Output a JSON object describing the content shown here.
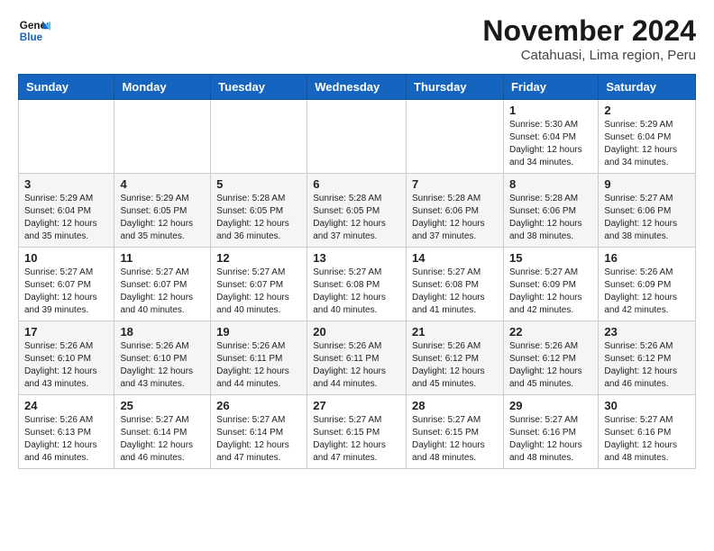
{
  "logo": {
    "line1": "General",
    "line2": "Blue"
  },
  "title": "November 2024",
  "subtitle": "Catahuasi, Lima region, Peru",
  "days_of_week": [
    "Sunday",
    "Monday",
    "Tuesday",
    "Wednesday",
    "Thursday",
    "Friday",
    "Saturday"
  ],
  "weeks": [
    [
      {
        "day": "",
        "info": ""
      },
      {
        "day": "",
        "info": ""
      },
      {
        "day": "",
        "info": ""
      },
      {
        "day": "",
        "info": ""
      },
      {
        "day": "",
        "info": ""
      },
      {
        "day": "1",
        "info": "Sunrise: 5:30 AM\nSunset: 6:04 PM\nDaylight: 12 hours and 34 minutes."
      },
      {
        "day": "2",
        "info": "Sunrise: 5:29 AM\nSunset: 6:04 PM\nDaylight: 12 hours and 34 minutes."
      }
    ],
    [
      {
        "day": "3",
        "info": "Sunrise: 5:29 AM\nSunset: 6:04 PM\nDaylight: 12 hours and 35 minutes."
      },
      {
        "day": "4",
        "info": "Sunrise: 5:29 AM\nSunset: 6:05 PM\nDaylight: 12 hours and 35 minutes."
      },
      {
        "day": "5",
        "info": "Sunrise: 5:28 AM\nSunset: 6:05 PM\nDaylight: 12 hours and 36 minutes."
      },
      {
        "day": "6",
        "info": "Sunrise: 5:28 AM\nSunset: 6:05 PM\nDaylight: 12 hours and 37 minutes."
      },
      {
        "day": "7",
        "info": "Sunrise: 5:28 AM\nSunset: 6:06 PM\nDaylight: 12 hours and 37 minutes."
      },
      {
        "day": "8",
        "info": "Sunrise: 5:28 AM\nSunset: 6:06 PM\nDaylight: 12 hours and 38 minutes."
      },
      {
        "day": "9",
        "info": "Sunrise: 5:27 AM\nSunset: 6:06 PM\nDaylight: 12 hours and 38 minutes."
      }
    ],
    [
      {
        "day": "10",
        "info": "Sunrise: 5:27 AM\nSunset: 6:07 PM\nDaylight: 12 hours and 39 minutes."
      },
      {
        "day": "11",
        "info": "Sunrise: 5:27 AM\nSunset: 6:07 PM\nDaylight: 12 hours and 40 minutes."
      },
      {
        "day": "12",
        "info": "Sunrise: 5:27 AM\nSunset: 6:07 PM\nDaylight: 12 hours and 40 minutes."
      },
      {
        "day": "13",
        "info": "Sunrise: 5:27 AM\nSunset: 6:08 PM\nDaylight: 12 hours and 40 minutes."
      },
      {
        "day": "14",
        "info": "Sunrise: 5:27 AM\nSunset: 6:08 PM\nDaylight: 12 hours and 41 minutes."
      },
      {
        "day": "15",
        "info": "Sunrise: 5:27 AM\nSunset: 6:09 PM\nDaylight: 12 hours and 42 minutes."
      },
      {
        "day": "16",
        "info": "Sunrise: 5:26 AM\nSunset: 6:09 PM\nDaylight: 12 hours and 42 minutes."
      }
    ],
    [
      {
        "day": "17",
        "info": "Sunrise: 5:26 AM\nSunset: 6:10 PM\nDaylight: 12 hours and 43 minutes."
      },
      {
        "day": "18",
        "info": "Sunrise: 5:26 AM\nSunset: 6:10 PM\nDaylight: 12 hours and 43 minutes."
      },
      {
        "day": "19",
        "info": "Sunrise: 5:26 AM\nSunset: 6:11 PM\nDaylight: 12 hours and 44 minutes."
      },
      {
        "day": "20",
        "info": "Sunrise: 5:26 AM\nSunset: 6:11 PM\nDaylight: 12 hours and 44 minutes."
      },
      {
        "day": "21",
        "info": "Sunrise: 5:26 AM\nSunset: 6:12 PM\nDaylight: 12 hours and 45 minutes."
      },
      {
        "day": "22",
        "info": "Sunrise: 5:26 AM\nSunset: 6:12 PM\nDaylight: 12 hours and 45 minutes."
      },
      {
        "day": "23",
        "info": "Sunrise: 5:26 AM\nSunset: 6:12 PM\nDaylight: 12 hours and 46 minutes."
      }
    ],
    [
      {
        "day": "24",
        "info": "Sunrise: 5:26 AM\nSunset: 6:13 PM\nDaylight: 12 hours and 46 minutes."
      },
      {
        "day": "25",
        "info": "Sunrise: 5:27 AM\nSunset: 6:14 PM\nDaylight: 12 hours and 46 minutes."
      },
      {
        "day": "26",
        "info": "Sunrise: 5:27 AM\nSunset: 6:14 PM\nDaylight: 12 hours and 47 minutes."
      },
      {
        "day": "27",
        "info": "Sunrise: 5:27 AM\nSunset: 6:15 PM\nDaylight: 12 hours and 47 minutes."
      },
      {
        "day": "28",
        "info": "Sunrise: 5:27 AM\nSunset: 6:15 PM\nDaylight: 12 hours and 48 minutes."
      },
      {
        "day": "29",
        "info": "Sunrise: 5:27 AM\nSunset: 6:16 PM\nDaylight: 12 hours and 48 minutes."
      },
      {
        "day": "30",
        "info": "Sunrise: 5:27 AM\nSunset: 6:16 PM\nDaylight: 12 hours and 48 minutes."
      }
    ]
  ]
}
